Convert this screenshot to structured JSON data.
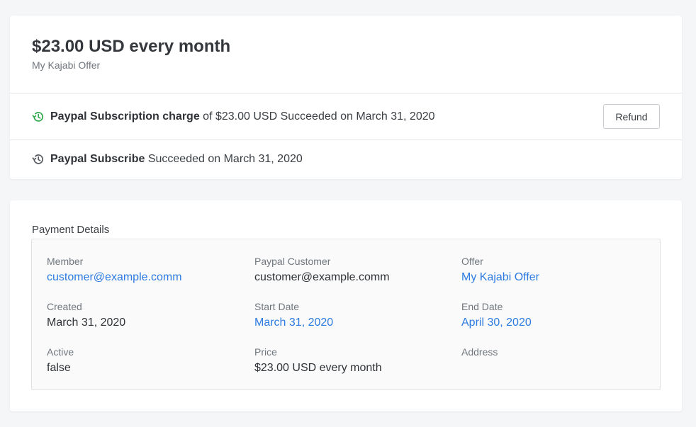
{
  "subscription": {
    "title": "$23.00 USD every month",
    "subtitle": "My Kajabi Offer"
  },
  "events": [
    {
      "icon": "history-icon",
      "icon_color": "#2ea84a",
      "name": "Paypal Subscription charge",
      "detail": " of $23.00 USD Succeeded on March 31, 2020",
      "action_label": "Refund"
    },
    {
      "icon": "history-icon",
      "icon_color": "#555b61",
      "name": "Paypal Subscribe",
      "detail": " Succeeded on March 31, 2020"
    }
  ],
  "payment_details": {
    "heading": "Payment Details",
    "member": {
      "label": "Member",
      "value": "customer@example.comm"
    },
    "paypal_customer": {
      "label": "Paypal Customer",
      "value": "customer@example.comm"
    },
    "offer": {
      "label": "Offer",
      "value": "My Kajabi Offer"
    },
    "created": {
      "label": "Created",
      "value": "March 31, 2020"
    },
    "start_date": {
      "label": "Start Date",
      "value": "March 31, 2020"
    },
    "end_date": {
      "label": "End Date",
      "value": "April 30, 2020"
    },
    "active": {
      "label": "Active",
      "value": "false"
    },
    "price": {
      "label": "Price",
      "value": "$23.00 USD every month"
    },
    "address": {
      "label": "Address",
      "value": ""
    }
  },
  "colors": {
    "link": "#2d7be0",
    "success": "#2ea84a",
    "background": "#f5f6f8"
  }
}
